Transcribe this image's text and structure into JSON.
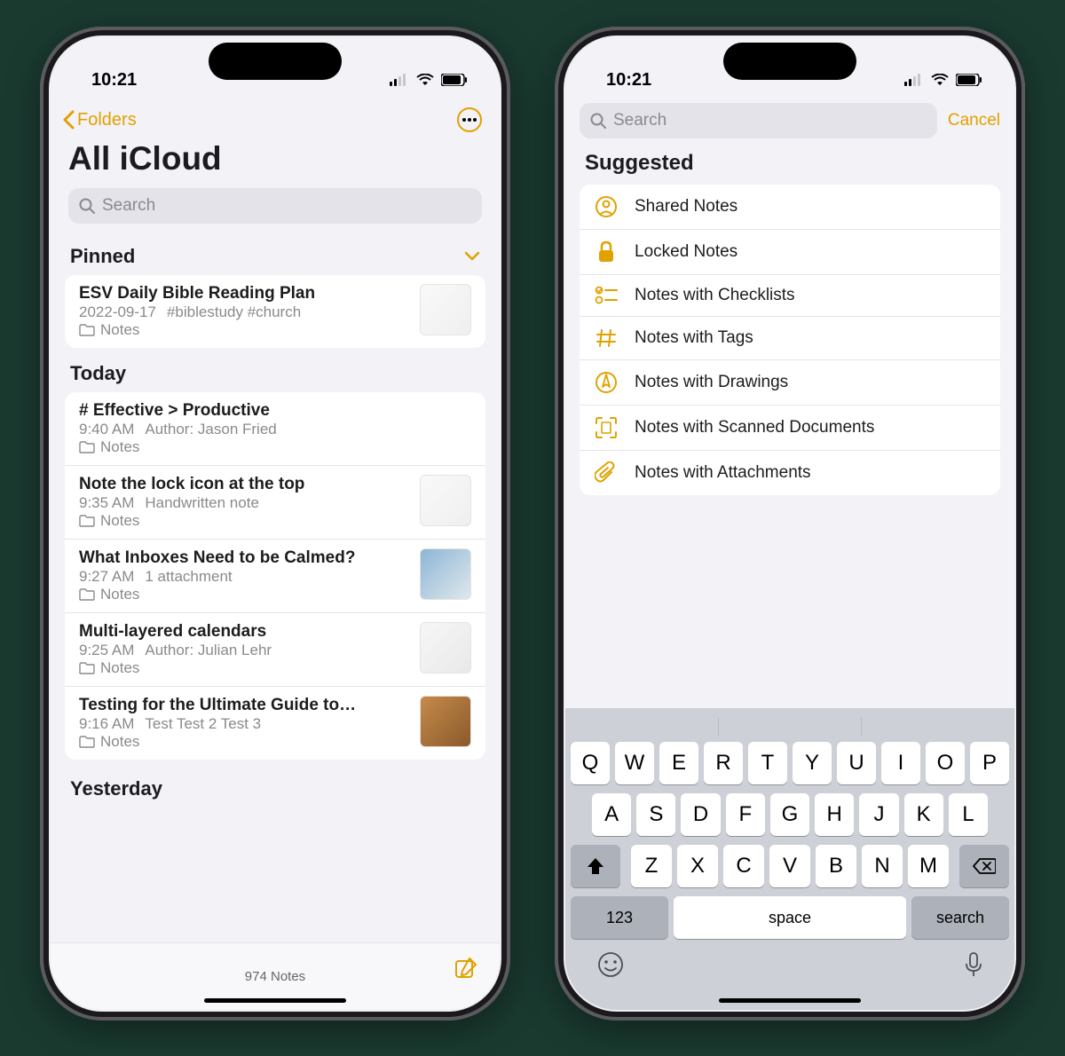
{
  "status": {
    "time": "10:21"
  },
  "left": {
    "back_label": "Folders",
    "title": "All iCloud",
    "search_placeholder": "Search",
    "sections": {
      "pinned": {
        "label": "Pinned",
        "items": [
          {
            "title": "ESV Daily Bible Reading Plan",
            "time": "2022-09-17",
            "sub": "#biblestudy #church",
            "folder": "Notes",
            "thumb": "paper"
          }
        ]
      },
      "today": {
        "label": "Today",
        "items": [
          {
            "title": "# Effective > Productive",
            "time": "9:40 AM",
            "sub": "Author: Jason Fried",
            "folder": "Notes",
            "thumb": null
          },
          {
            "title": "Note the lock icon at the top",
            "time": "9:35 AM",
            "sub": "Handwritten note",
            "folder": "Notes",
            "thumb": "paper"
          },
          {
            "title": "What Inboxes Need to be Calmed?",
            "time": "9:27 AM",
            "sub": "1 attachment",
            "folder": "Notes",
            "thumb": "photo"
          },
          {
            "title": "Multi-layered calendars",
            "time": "9:25 AM",
            "sub": "Author: Julian Lehr",
            "folder": "Notes",
            "thumb": "cards"
          },
          {
            "title": "Testing for the Ultimate Guide to…",
            "time": "9:16 AM",
            "sub": "Test Test 2 Test 3",
            "folder": "Notes",
            "thumb": "wood"
          }
        ]
      },
      "yesterday": {
        "label": "Yesterday"
      }
    },
    "footer_count": "974 Notes"
  },
  "right": {
    "search_placeholder": "Search",
    "cancel_label": "Cancel",
    "suggested_label": "Suggested",
    "suggestions": [
      {
        "icon": "person-circle",
        "label": "Shared Notes"
      },
      {
        "icon": "lock",
        "label": "Locked Notes"
      },
      {
        "icon": "checklist",
        "label": "Notes with Checklists"
      },
      {
        "icon": "hash",
        "label": "Notes with Tags"
      },
      {
        "icon": "drawing",
        "label": "Notes with Drawings"
      },
      {
        "icon": "scan",
        "label": "Notes with Scanned Documents"
      },
      {
        "icon": "paperclip",
        "label": "Notes with Attachments"
      }
    ],
    "keyboard": {
      "row1": [
        "Q",
        "W",
        "E",
        "R",
        "T",
        "Y",
        "U",
        "I",
        "O",
        "P"
      ],
      "row2": [
        "A",
        "S",
        "D",
        "F",
        "G",
        "H",
        "J",
        "K",
        "L"
      ],
      "row3": [
        "Z",
        "X",
        "C",
        "V",
        "B",
        "N",
        "M"
      ],
      "numbers_label": "123",
      "space_label": "space",
      "search_label": "search"
    }
  }
}
